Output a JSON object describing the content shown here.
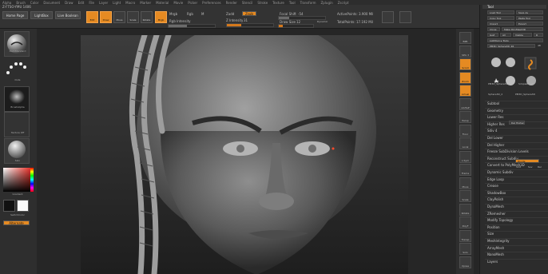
{
  "menu": [
    "Alpha",
    "Brush",
    "Color",
    "Document",
    "Draw",
    "Edit",
    "File",
    "Layer",
    "Light",
    "Macro",
    "Marker",
    "Material",
    "Movie",
    "Picker",
    "Preferences",
    "Render",
    "Stencil",
    "Stroke",
    "Texture",
    "Tool",
    "Transform",
    "Zplugin",
    "Zscript"
  ],
  "version": "Z-FTSO-YMU 1406",
  "shelf": {
    "home_page": "Home Page",
    "lightbox": "LightBox",
    "live_boolean": "Live Boolean",
    "edit": "Edit",
    "draw": "Draw",
    "move": "Move",
    "scale": "Scale",
    "rotate": "Rotate",
    "mrgb": "Mrgb",
    "rgb": "Rgb",
    "m": "M",
    "rgb_intensity": "Rgb Intensity",
    "zadd": "Zadd",
    "zsub": "Zsub",
    "z_intensity_label": "Z Intensity",
    "z_intensity_value": "31",
    "focal_shift_label": "Focal Shift",
    "focal_shift_value": "-54",
    "draw_size_label": "Draw Size",
    "draw_size_value": "12",
    "dynamic": "Dynamic",
    "active_points": "ActivePoints: 3.900 Mil",
    "total_points": "TotalPoints: 17.192 Mil",
    "accent": "#e58a22"
  },
  "left": {
    "brush": "DamStandard",
    "stroke": "Dots",
    "alpha": "BrushAlpha",
    "texture": "Texture Off",
    "material": "Skin",
    "gradient": "Gradient",
    "switch_color": "SwitchColor",
    "alternate": "Alternate"
  },
  "right": [
    "BPR",
    "SPix 3",
    "Scroll",
    "Zoom",
    "Actual",
    "AAHalf",
    "Persp",
    "Floor",
    "Local",
    "L.Sym",
    "Frame",
    "Move",
    "Scale",
    "Rotate",
    "PolyF",
    "Transp",
    "Solo",
    "Xpose"
  ],
  "tray": {
    "title": "Tool",
    "load_tool": "Load Tool",
    "save_as": "Save As",
    "copy_tool": "Copy Tool",
    "paste_tool": "Paste Tool",
    "import": "Import",
    "export": "Export",
    "clone": "Clone",
    "make_polymesh": "Make PolyMesh3D",
    "goz": "GoZ",
    "all": "All",
    "visible": "Visible",
    "r": "R",
    "lightbox_tools": "Lightbox ▸ Tools",
    "current_tool": "PM3D_Sphere3D_46",
    "count": "48",
    "subtools": [
      "PM3D_Sphere3D",
      "Cylinder3D",
      "PM3D_Sphere3D_1",
      "SimpleBrush",
      "Sphere3D_2",
      "PolyMesh3D",
      "PM3D_Sphere3D"
    ],
    "sections": [
      "Subtool",
      "Geometry",
      "Lower Res",
      "Higher Res",
      "Sdiv 4",
      "Del Lower",
      "Del Higher",
      "Freeze SubDivision Levels",
      "Reconstruct Subdiv",
      "Convert to PolyMesh3D",
      "Dynamic Subdiv",
      "Edge Loop",
      "Crease",
      "ShadowBox",
      "ClayPolish",
      "DynaMesh",
      "ZRemesher",
      "Modify Topology",
      "Position",
      "Size",
      "MeshIntegrity",
      "ArrayMesh",
      "NanoMesh",
      "Layers"
    ],
    "smt": "Smt",
    "suv": "Suv",
    "rel": "Rel",
    "divide": "Divide"
  }
}
